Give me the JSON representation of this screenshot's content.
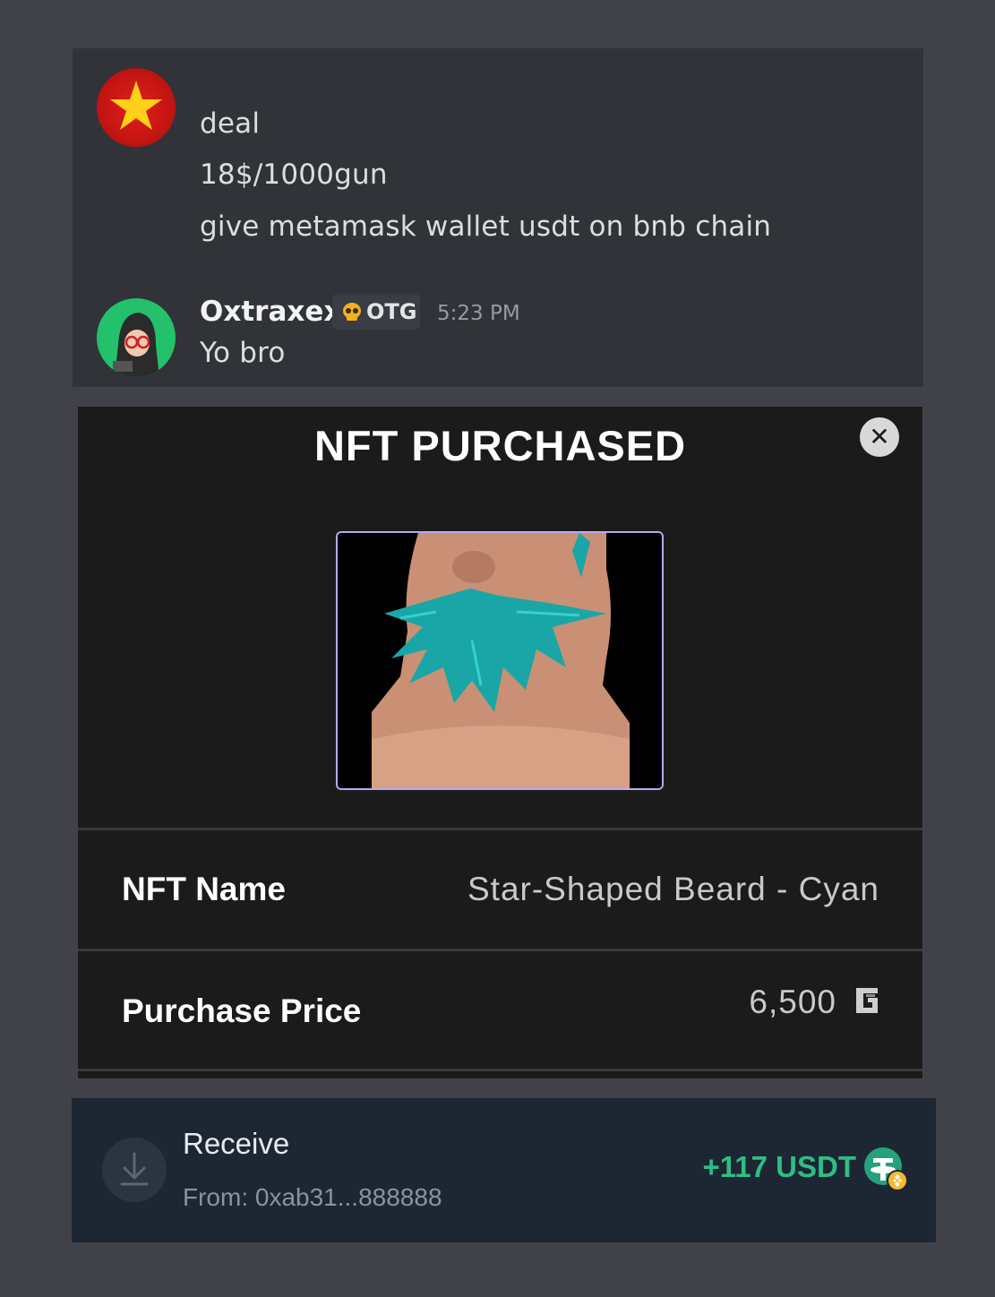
{
  "chat": {
    "messages_first": [
      "deal",
      "18$/1000gun",
      "give metamask wallet usdt on bnb chain"
    ],
    "second": {
      "username": "Oxtraxex",
      "role_tag": "OTG",
      "timestamp": "5:23 PM",
      "text": "Yo bro"
    }
  },
  "modal": {
    "title": "NFT PURCHASED",
    "close_icon": "close-icon",
    "nft_name_label": "NFT Name",
    "nft_name_value": "Star-Shaped Beard - Cyan",
    "price_label": "Purchase Price",
    "price_value": "6,500",
    "currency_icon": "gun-currency-icon"
  },
  "receive": {
    "title": "Receive",
    "from": "From: 0xab31...888888",
    "amount": "+117 USDT",
    "icons": [
      "download-icon",
      "usdt-bnb-token-icon"
    ]
  },
  "colors": {
    "page_bg": "#414249",
    "chat_bg": "#313338",
    "modal_bg": "#1b1b1c",
    "receive_bg": "#1d2633",
    "amount_green": "#2ebd85",
    "beard_cyan": "#1aa6a6"
  }
}
